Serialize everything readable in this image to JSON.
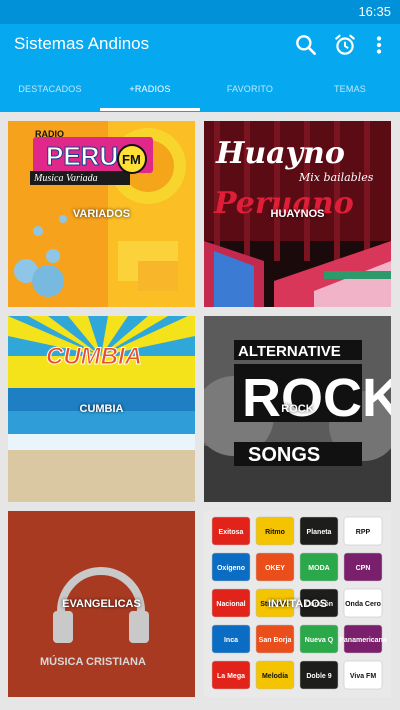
{
  "status_bar": {
    "time": "16:35"
  },
  "toolbar": {
    "title": "Sistemas Andinos",
    "icons": [
      "search-icon",
      "alarm-icon",
      "more-vert-icon"
    ]
  },
  "tabs": [
    {
      "label": "DESTACADOS",
      "active": false
    },
    {
      "label": "+RADIOS",
      "active": true
    },
    {
      "label": "FAVORITO",
      "active": false
    },
    {
      "label": "TEMAS",
      "active": false
    }
  ],
  "cards": [
    {
      "label": "VARIADOS",
      "art": {
        "line1": "RADIO",
        "line2": "PERU",
        "line3": "Musica Variada",
        "badge": "FM"
      }
    },
    {
      "label": "HUAYNOS",
      "art": {
        "line1": "Huayno",
        "line2": "Mix bailables",
        "line3": "Peruano"
      }
    },
    {
      "label": "CUMBIA",
      "art": {
        "line1": "CUMBIA"
      }
    },
    {
      "label": "ROCK",
      "art": {
        "line1": "ALTERNATIVE",
        "line2": "ROCK",
        "line3": "SONGS"
      }
    },
    {
      "label": "EVANGELICAS",
      "art": {
        "line1": "MÚSICA CRISTIANA"
      }
    },
    {
      "label": "INVITADOS",
      "art": {
        "logos": [
          "Exitosa",
          "Ritmo",
          "Planeta",
          "RPP",
          "Oxígeno",
          "OKEY",
          "MODA",
          "CPN",
          "Nacional",
          "Studio92",
          "Corazón",
          "Onda Cero",
          "Inca",
          "San Borja",
          "Nueva Q",
          "Panamericana",
          "La Mega",
          "Melodía",
          "Doble 9",
          "Viva FM"
        ]
      }
    }
  ],
  "colors": {
    "status_bar": "#0091d8",
    "toolbar": "#06a9f0",
    "tab_active": "#ffffff",
    "tab_inactive": "#bfe6fb",
    "background": "#e6e6e6"
  }
}
